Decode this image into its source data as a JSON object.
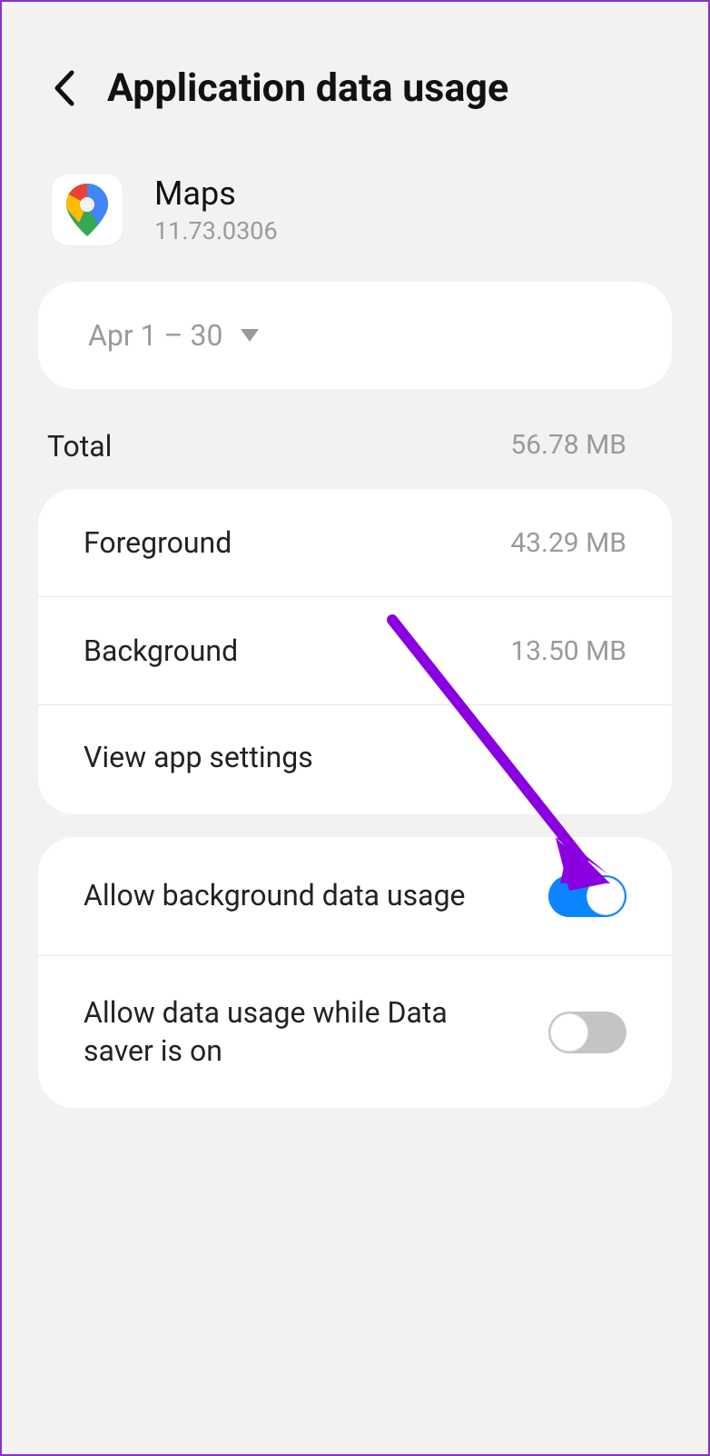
{
  "header": {
    "title": "Application data usage"
  },
  "app": {
    "name": "Maps",
    "version": "11.73.0306"
  },
  "period": {
    "label": "Apr 1 – 30"
  },
  "stats": {
    "total": {
      "label": "Total",
      "value": "56.78 MB"
    },
    "foreground": {
      "label": "Foreground",
      "value": "43.29 MB"
    },
    "background": {
      "label": "Background",
      "value": "13.50 MB"
    },
    "view_settings": "View app settings"
  },
  "toggles": {
    "bg_data": {
      "label": "Allow background data usage",
      "on": true
    },
    "data_saver": {
      "label": "Allow data usage while Data saver is on",
      "on": false
    }
  }
}
